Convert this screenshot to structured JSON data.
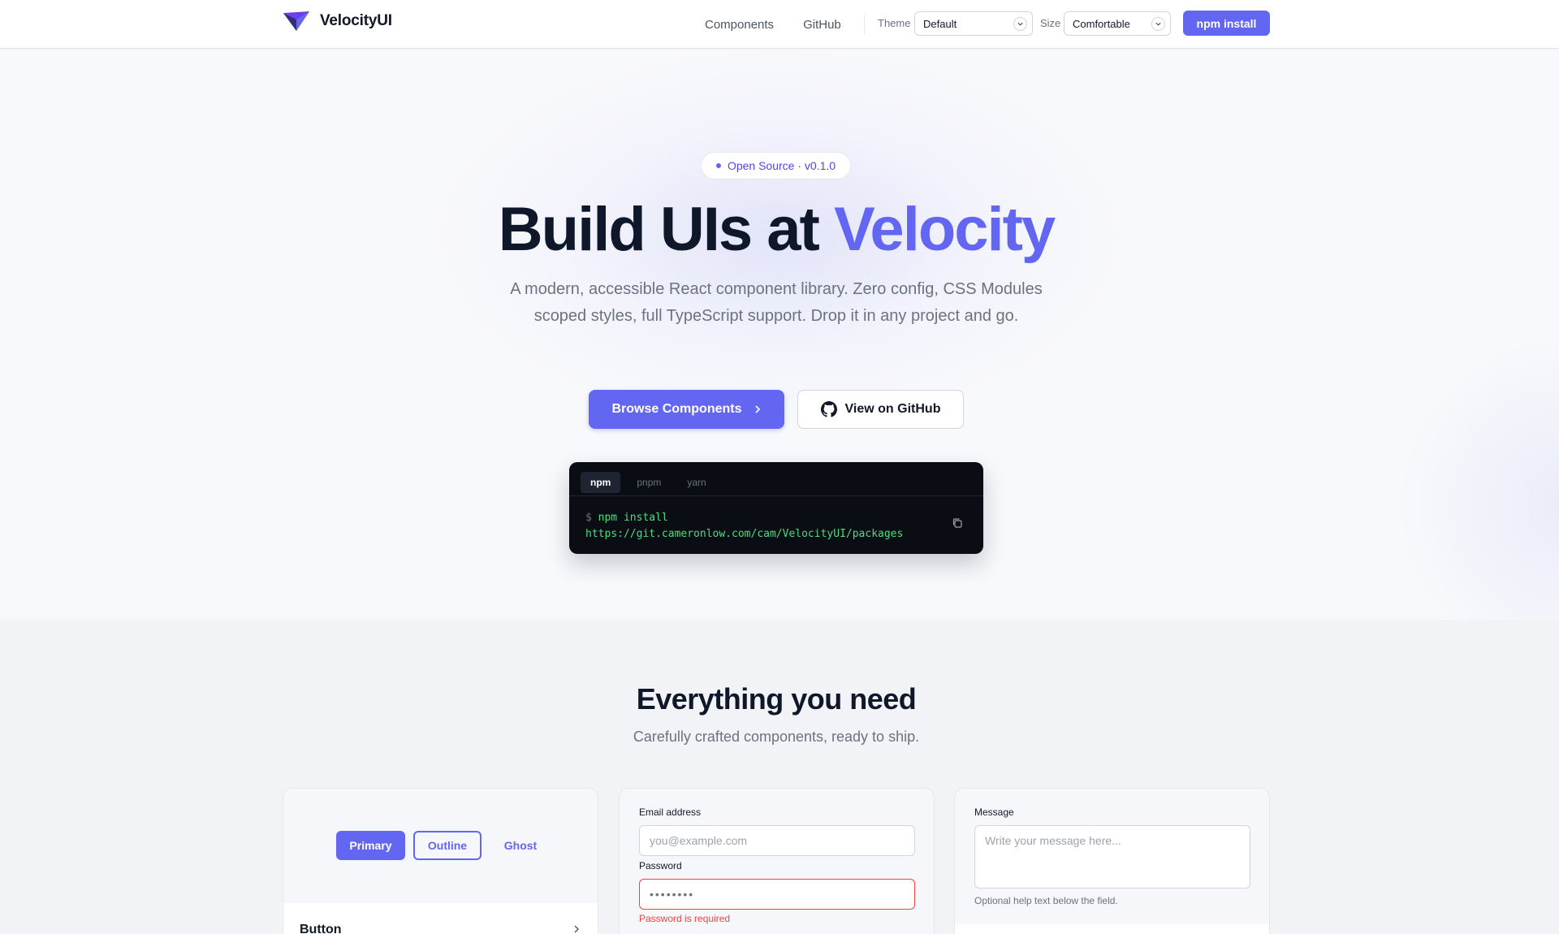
{
  "nav": {
    "brand": "VelocityUI",
    "links": [
      "Components",
      "GitHub"
    ],
    "theme_label": "Theme",
    "theme_value": "Default",
    "size_label": "Size",
    "size_value": "Comfortable",
    "npm_button": "npm install"
  },
  "hero": {
    "badge": "Open Source · v0.1.0",
    "title_main": "Build UIs at ",
    "title_accent": "Velocity",
    "subtitle": "A modern, accessible React component library. Zero config, CSS Modules scoped styles, full TypeScript support. Drop it in any project and go.",
    "browse_button": "Browse Components",
    "github_button": "View on GitHub"
  },
  "install": {
    "tabs": [
      "npm",
      "pnpm",
      "yarn"
    ],
    "active_tab": "npm",
    "prompt": "$",
    "command_line1": "npm install",
    "command_line2": "https://git.cameronlow.com/cam/VelocityUI/packages"
  },
  "features": {
    "title": "Everything you need",
    "subtitle": "Carefully crafted components, ready to ship.",
    "button_card": {
      "primary": "Primary",
      "outline": "Outline",
      "ghost": "Ghost",
      "footer_label": "Button"
    },
    "input_card": {
      "email_label": "Email address",
      "email_placeholder": "you@example.com",
      "password_label": "Password",
      "password_value": "••••••••",
      "password_error": "Password is required"
    },
    "textarea_card": {
      "message_label": "Message",
      "message_placeholder": "Write your message here...",
      "help_text": "Optional help text below the field."
    }
  },
  "colors": {
    "accent": "#6366f1",
    "error": "#ef4444",
    "code_bg": "#0b0d14",
    "code_text": "#4ade80"
  }
}
